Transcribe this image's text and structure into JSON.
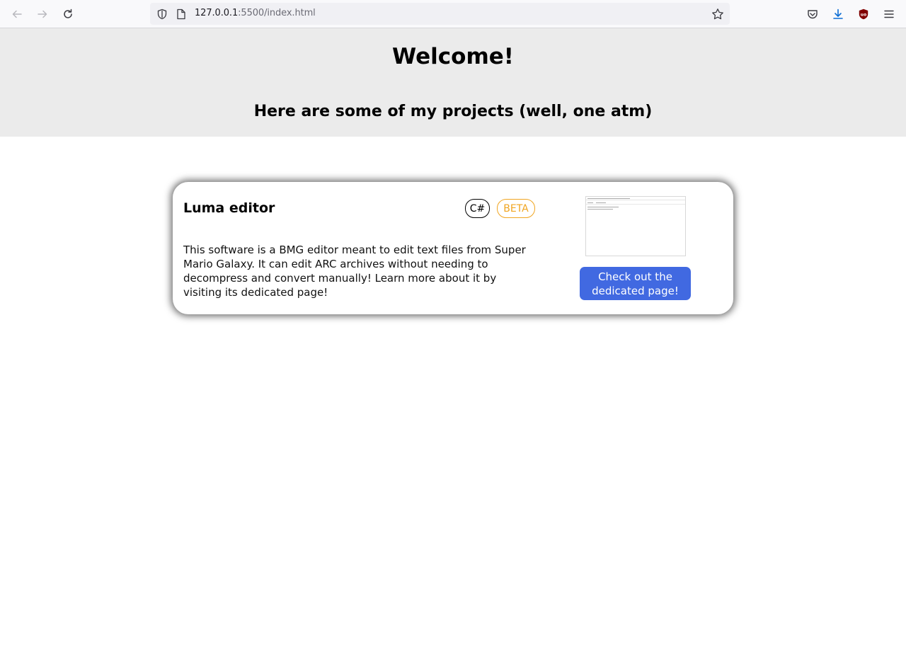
{
  "browser": {
    "url_host": "127.0.0.1",
    "url_rest": ":5500/index.html",
    "icons": [
      "back-icon",
      "forward-icon",
      "reload-icon",
      "shield-icon",
      "page-icon",
      "bookmark-star-icon",
      "pocket-icon",
      "download-icon",
      "ublock-icon",
      "menu-icon"
    ]
  },
  "header": {
    "title": "Welcome!",
    "subtitle": "Here are some of my projects (well, one atm)"
  },
  "project": {
    "title": "Luma editor",
    "badges": {
      "language": "C#",
      "status": "BETA"
    },
    "description": "This software is a BMG editor meant to edit text files from Super Mario Galaxy. It can edit ARC archives without needing to decompress and convert manually! Learn more about it by visiting its dedicated page!",
    "button_label": "Check out the dedicated page!"
  },
  "colors": {
    "header_bg": "#ebebeb",
    "button_bg": "#4169e1",
    "beta_color": "#f0a521"
  }
}
